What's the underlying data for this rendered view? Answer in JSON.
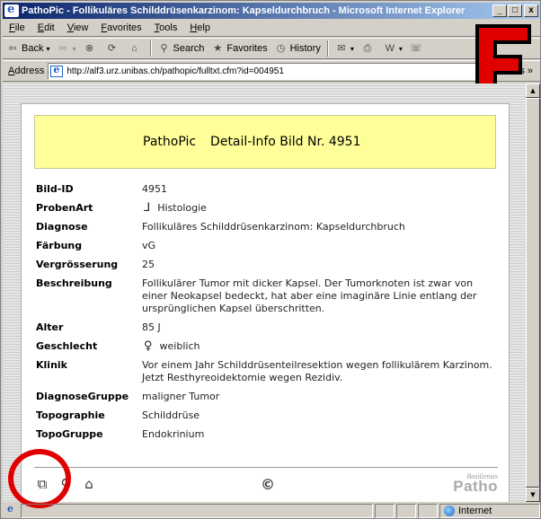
{
  "window": {
    "title": "PathoPic - Follikuläres Schilddrüsenkarzinom: Kapseldurchbruch - Microsoft Internet Explorer",
    "controls": {
      "minimize": "_",
      "maximize": "□",
      "close": "x"
    }
  },
  "menu": [
    "File",
    "Edit",
    "View",
    "Favorites",
    "Tools",
    "Help"
  ],
  "toolbar": {
    "back": "Back",
    "search": "Search",
    "favorites": "Favorites",
    "history": "History"
  },
  "address": {
    "label": "Address",
    "url": "http://alf3.urz.unibas.ch/pathopic/fulltxt.cfm?id=004951",
    "links": "Links »"
  },
  "logo_letter": "F",
  "page": {
    "site": "PathoPic",
    "heading": "Detail-Info Bild Nr. 4951",
    "fields": [
      {
        "key": "Bild-ID",
        "value": "4951"
      },
      {
        "key": "ProbenArt",
        "value": "Histologie",
        "icon": "microscope-icon"
      },
      {
        "key": "Diagnose",
        "value": "Follikuläres Schilddrüsenkarzinom: Kapseldurchbruch"
      },
      {
        "key": "Färbung",
        "value": "vG"
      },
      {
        "key": "Vergrösserung",
        "value": "25"
      },
      {
        "key": "Beschreibung",
        "value": "Follikulärer Tumor mit dicker Kapsel. Der Tumorknoten ist zwar von einer Neokapsel bedeckt, hat aber eine imaginäre Linie entlang der ursprünglichen Kapsel überschritten."
      },
      {
        "key": "Alter",
        "value": "85 J"
      },
      {
        "key": "Geschlecht",
        "value": "weiblich",
        "icon": "female-icon"
      },
      {
        "key": "Klinik",
        "value": "Vor einem Jahr Schilddrüsenteilresektion wegen follikulärem Karzinom. Jetzt Resthyreoidektomie wegen Rezidiv."
      },
      {
        "key": "DiagnoseGruppe",
        "value": "maligner Tumor"
      },
      {
        "key": "Topographie",
        "value": "Schilddrüse"
      },
      {
        "key": "TopoGruppe",
        "value": "Endokrinium"
      }
    ],
    "footer": {
      "copyright": "©",
      "brand_small": "Basiliensis",
      "brand_big": "Patho"
    }
  },
  "statusbar": {
    "zone": "Internet"
  },
  "colors": {
    "header_bg": "#ffff99",
    "title_bar": "#0a246a",
    "highlight_circle": "#e00000",
    "logo_red": "#e00000"
  }
}
